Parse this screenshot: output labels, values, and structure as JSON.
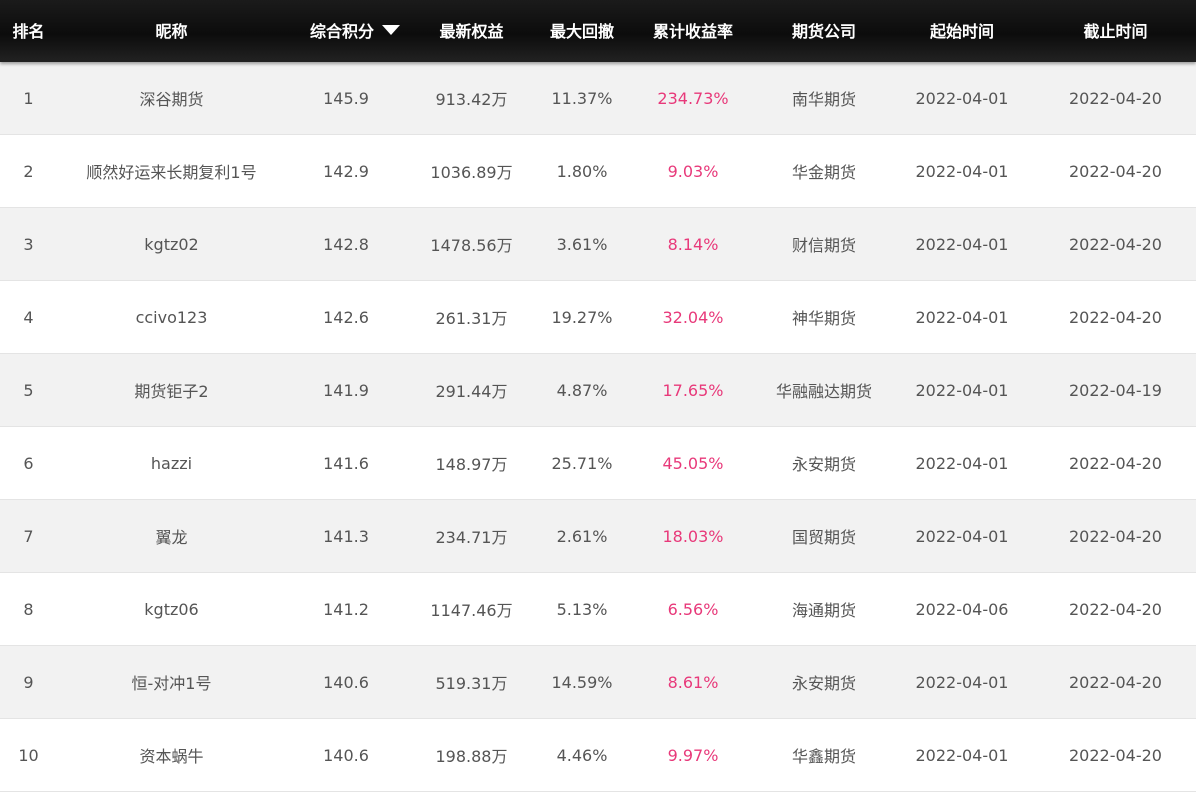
{
  "header": {
    "rank": "排名",
    "nickname": "昵称",
    "score": "综合积分",
    "equity": "最新权益",
    "max_drawdown": "最大回撤",
    "cum_return": "累计收益率",
    "company": "期货公司",
    "start_date": "起始时间",
    "end_date": "截止时间",
    "sort_icon": "sort-desc-icon"
  },
  "colors": {
    "header_bg": "#111111",
    "header_text": "#ffffff",
    "row_odd": "#f2f2f2",
    "row_even": "#ffffff",
    "body_text": "#555555",
    "return_text": "#e8397a"
  },
  "rows": [
    {
      "rank": "1",
      "nickname": "深谷期货",
      "score": "145.9",
      "equity": "913.42万",
      "max_drawdown": "11.37%",
      "cum_return": "234.73%",
      "company": "南华期货",
      "start_date": "2022-04-01",
      "end_date": "2022-04-20"
    },
    {
      "rank": "2",
      "nickname": "顺然好运来长期复利1号",
      "score": "142.9",
      "equity": "1036.89万",
      "max_drawdown": "1.80%",
      "cum_return": "9.03%",
      "company": "华金期货",
      "start_date": "2022-04-01",
      "end_date": "2022-04-20"
    },
    {
      "rank": "3",
      "nickname": "kgtz02",
      "score": "142.8",
      "equity": "1478.56万",
      "max_drawdown": "3.61%",
      "cum_return": "8.14%",
      "company": "财信期货",
      "start_date": "2022-04-01",
      "end_date": "2022-04-20"
    },
    {
      "rank": "4",
      "nickname": "ccivo123",
      "score": "142.6",
      "equity": "261.31万",
      "max_drawdown": "19.27%",
      "cum_return": "32.04%",
      "company": "神华期货",
      "start_date": "2022-04-01",
      "end_date": "2022-04-20"
    },
    {
      "rank": "5",
      "nickname": "期货钜子2",
      "score": "141.9",
      "equity": "291.44万",
      "max_drawdown": "4.87%",
      "cum_return": "17.65%",
      "company": "华融融达期货",
      "start_date": "2022-04-01",
      "end_date": "2022-04-19"
    },
    {
      "rank": "6",
      "nickname": "hazzi",
      "score": "141.6",
      "equity": "148.97万",
      "max_drawdown": "25.71%",
      "cum_return": "45.05%",
      "company": "永安期货",
      "start_date": "2022-04-01",
      "end_date": "2022-04-20"
    },
    {
      "rank": "7",
      "nickname": "翼龙",
      "score": "141.3",
      "equity": "234.71万",
      "max_drawdown": "2.61%",
      "cum_return": "18.03%",
      "company": "国贸期货",
      "start_date": "2022-04-01",
      "end_date": "2022-04-20"
    },
    {
      "rank": "8",
      "nickname": "kgtz06",
      "score": "141.2",
      "equity": "1147.46万",
      "max_drawdown": "5.13%",
      "cum_return": "6.56%",
      "company": "海通期货",
      "start_date": "2022-04-06",
      "end_date": "2022-04-20"
    },
    {
      "rank": "9",
      "nickname": "恒-对冲1号",
      "score": "140.6",
      "equity": "519.31万",
      "max_drawdown": "14.59%",
      "cum_return": "8.61%",
      "company": "永安期货",
      "start_date": "2022-04-01",
      "end_date": "2022-04-20"
    },
    {
      "rank": "10",
      "nickname": "资本蜗牛",
      "score": "140.6",
      "equity": "198.88万",
      "max_drawdown": "4.46%",
      "cum_return": "9.97%",
      "company": "华鑫期货",
      "start_date": "2022-04-01",
      "end_date": "2022-04-20"
    }
  ]
}
